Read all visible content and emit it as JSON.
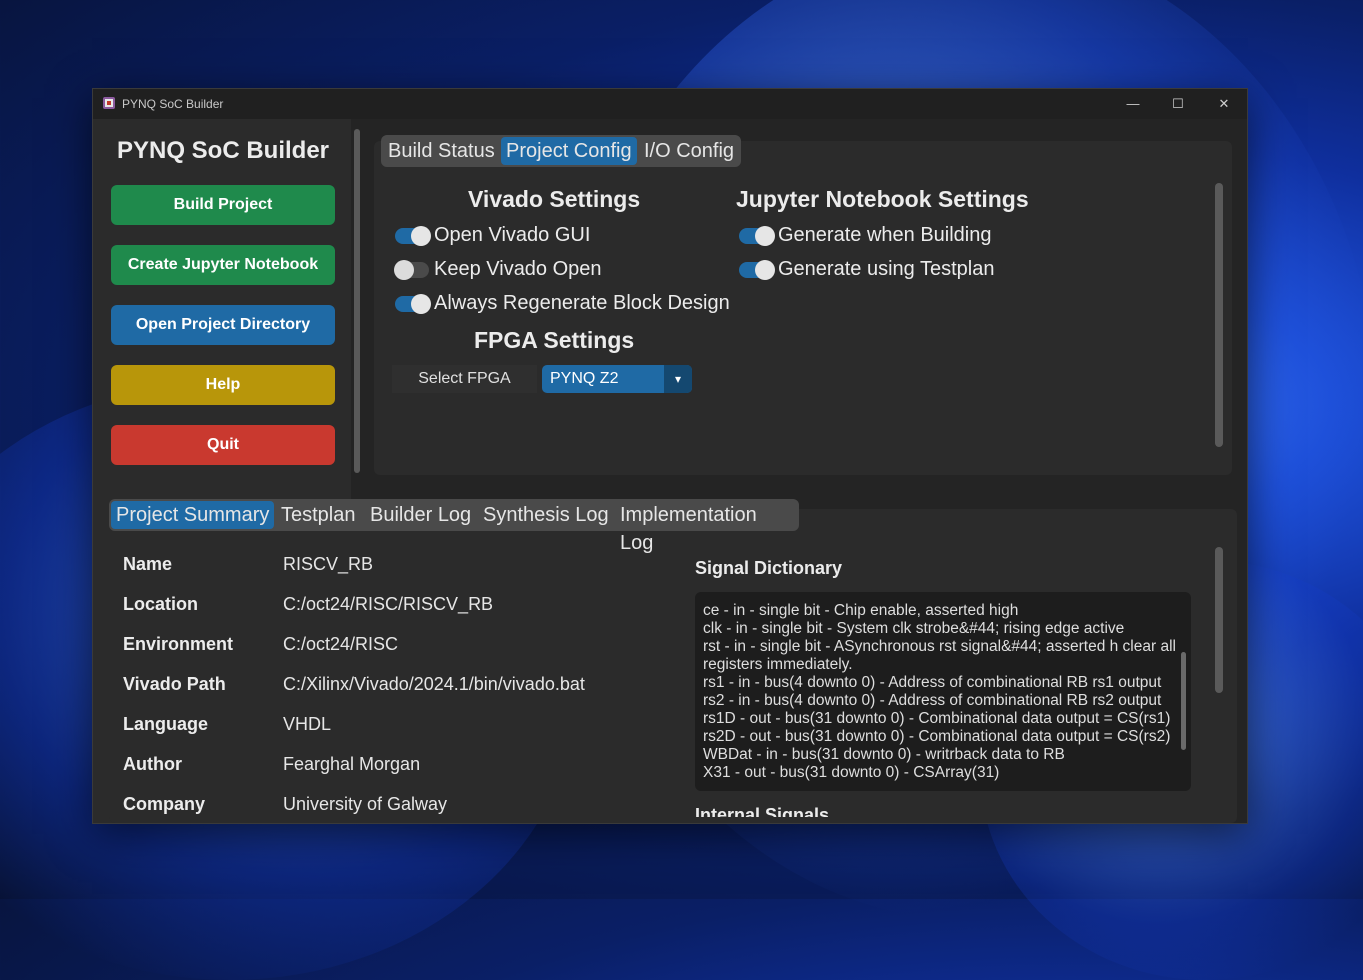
{
  "window": {
    "title": "PYNQ SoC Builder",
    "controls": {
      "minimize": "—",
      "maximize": "☐",
      "close": "✕"
    }
  },
  "sidebar": {
    "app_title": "PYNQ SoC Builder",
    "buttons": [
      {
        "label": "Build Project",
        "color": "#1f8a4c"
      },
      {
        "label": "Create Jupyter Notebook",
        "color": "#1f8a4c"
      },
      {
        "label": "Open Project Directory",
        "color": "#1f6aa5"
      },
      {
        "label": "Help",
        "color": "#b8960a"
      },
      {
        "label": "Quit",
        "color": "#c9392f"
      }
    ]
  },
  "top_tabs": [
    {
      "label": "Build Status",
      "selected": false
    },
    {
      "label": "Project Config",
      "selected": true
    },
    {
      "label": "I/O Config",
      "selected": false
    }
  ],
  "vivado_settings": {
    "title": "Vivado Settings",
    "options": [
      {
        "label": "Open Vivado GUI",
        "on": true
      },
      {
        "label": "Keep Vivado Open",
        "on": false
      },
      {
        "label": "Always Regenerate Block Design",
        "on": true
      }
    ]
  },
  "jupyter_settings": {
    "title": "Jupyter Notebook Settings",
    "options": [
      {
        "label": "Generate when Building",
        "on": true
      },
      {
        "label": "Generate using Testplan",
        "on": true
      }
    ]
  },
  "fpga_settings": {
    "title": "FPGA Settings",
    "select_label": "Select FPGA",
    "selected": "PYNQ Z2"
  },
  "bottom_tabs": [
    {
      "label": "Project Summary",
      "selected": true
    },
    {
      "label": "Testplan",
      "selected": false
    },
    {
      "label": "Builder Log",
      "selected": false
    },
    {
      "label": "Synthesis Log",
      "selected": false
    },
    {
      "label": "Implementation Log",
      "selected": false
    }
  ],
  "summary": [
    {
      "key": "Name",
      "value": "RISCV_RB"
    },
    {
      "key": "Location",
      "value": "C:/oct24/RISC/RISCV_RB"
    },
    {
      "key": "Environment",
      "value": "C:/oct24/RISC"
    },
    {
      "key": "Vivado Path",
      "value": "C:/Xilinx/Vivado/2024.1/bin/vivado.bat"
    },
    {
      "key": "Language",
      "value": "VHDL"
    },
    {
      "key": "Author",
      "value": "Fearghal Morgan"
    },
    {
      "key": "Company",
      "value": "University of Galway"
    }
  ],
  "signal_dictionary": {
    "title": "Signal Dictionary",
    "lines": [
      "ce - in - single bit - Chip enable, asserted high",
      "clk - in - single bit - System clk strobe&#44; rising edge active",
      "rst - in - single bit - ASynchronous rst signal&#44; asserted h clear all registers immediately.",
      "rs1 - in - bus(4 downto 0) - Address of combinational RB rs1 output",
      "rs2 - in - bus(4 downto 0) - Address of combinational RB rs2 output",
      "rs1D - out - bus(31 downto 0) - Combinational data output = CS(rs1)",
      "rs2D - out - bus(31 downto 0) - Combinational data output = CS(rs2)",
      "WBDat - in - bus(31 downto 0) - writrback data to RB",
      "X31 - out - bus(31 downto 0) - CSArray(31)"
    ]
  },
  "internal_signals_title": "Internal Signals"
}
